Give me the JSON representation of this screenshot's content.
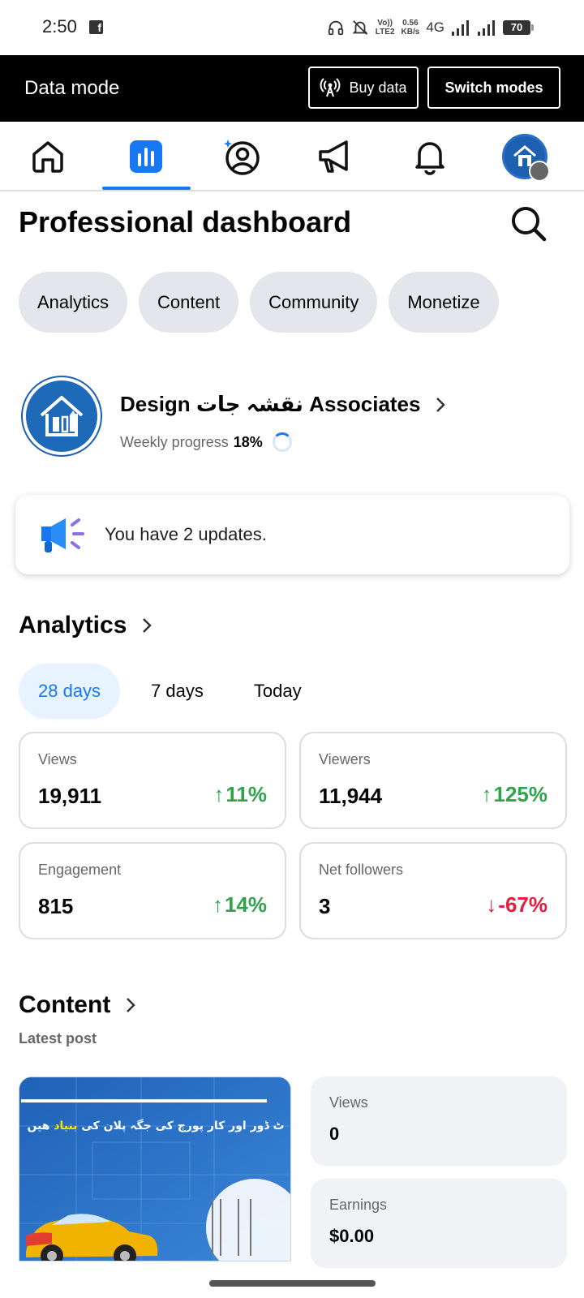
{
  "status_bar": {
    "time": "2:50",
    "volte_top": "Vo))",
    "volte_bottom": "LTE2",
    "speed_value": "0.56",
    "speed_unit": "KB/s",
    "network": "4G",
    "battery": "70"
  },
  "data_bar": {
    "title": "Data mode",
    "buy_label": "Buy data",
    "switch_label": "Switch modes"
  },
  "nav": {
    "items": [
      "home-icon",
      "dashboard-icon",
      "profile-icon",
      "megaphone-icon",
      "bell-icon",
      "avatar"
    ],
    "active_color": "#1877f2"
  },
  "header": {
    "title": "Professional dashboard"
  },
  "chips": [
    "Analytics",
    "Content",
    "Community",
    "Monetize"
  ],
  "profile": {
    "name": "Design نقشہ جات Associates",
    "progress_label": "Weekly progress",
    "progress_value": "18%",
    "progress_fraction": 0.18
  },
  "updates": {
    "text": "You have 2 updates."
  },
  "analytics": {
    "title": "Analytics",
    "tabs": [
      "28 days",
      "7 days",
      "Today"
    ],
    "active_tab": "28 days",
    "stats": [
      {
        "label": "Views",
        "value": "19,911",
        "change": "11%",
        "arrow": "↑"
      },
      {
        "label": "Viewers",
        "value": "11,944",
        "change": "125%",
        "arrow": "↑"
      },
      {
        "label": "Engagement",
        "value": "815",
        "change": "14%",
        "arrow": "↑"
      },
      {
        "label": "Net followers",
        "value": "3",
        "change": "-67%",
        "arrow": "↓"
      }
    ],
    "up_color": "#31a24c",
    "down_color": "#e41e3f"
  },
  "content": {
    "title": "Content",
    "latest_label": "Latest post",
    "thumb_text_white": "ٹ ڈور اور کار پورچ کی جگہ پلان کی ",
    "thumb_text_yellow": "بنیاد",
    "thumb_text_end": " ھیں",
    "views_label": "Views",
    "views_value": "0",
    "earnings_label": "Earnings",
    "earnings_value": "$0.00"
  }
}
